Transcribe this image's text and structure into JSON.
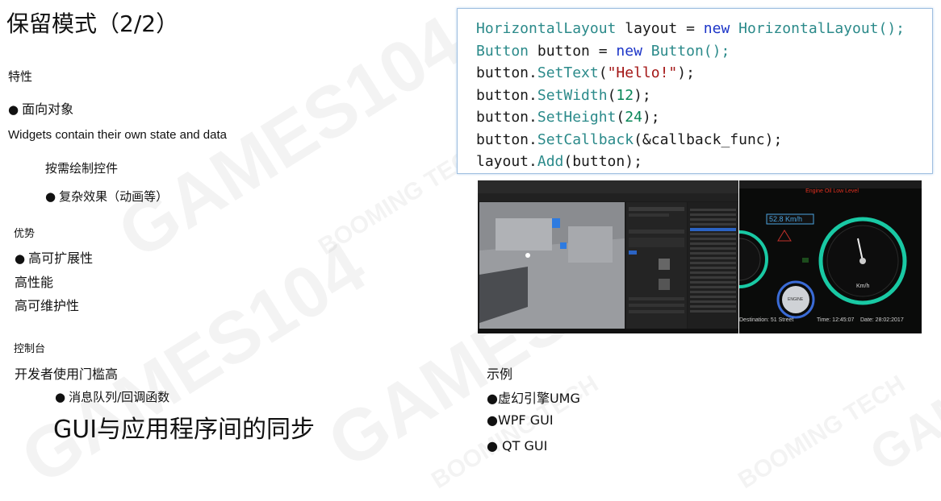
{
  "title": "保留模式（2/2）",
  "features": {
    "heading": "特性",
    "item1": "面向对象",
    "desc": "Widgets contain their own state and data",
    "sub1": "按需绘制控件",
    "sub2": "复杂效果（动画等）"
  },
  "advantages": {
    "heading": "优势",
    "item1": "高可扩展性",
    "item2": "高性能",
    "item3": "高可维护性"
  },
  "console": {
    "heading": "控制台",
    "item1": "开发者使用门槛高",
    "sub1": "消息队列/回调函数",
    "big": "GUI与应用程序间的同步"
  },
  "examples": {
    "heading": "示例",
    "items": [
      "●虚幻引擎UMG",
      "●WPF GUI",
      "● QT GUI"
    ]
  },
  "code": {
    "line1": {
      "type": "HorizontalLayout",
      "var": " layout = ",
      "kw": "new",
      "rest": " HorizontalLayout();"
    },
    "line2": {
      "type": "Button",
      "var": " button = ",
      "kw": "new",
      "rest": " Button();"
    },
    "line3": {
      "obj": "button.",
      "fn": "SetText",
      "open": "(",
      "str": "\"Hello!\"",
      "close": ");"
    },
    "line4": {
      "obj": "button.",
      "fn": "SetWidth",
      "open": "(",
      "num": "12",
      "close": ");"
    },
    "line5": {
      "obj": "button.",
      "fn": "SetHeight",
      "open": "(",
      "num": "24",
      "close": ");"
    },
    "line6": {
      "obj": "button.",
      "fn": "SetCallback",
      "args": "(&callback_func);"
    },
    "line7": {
      "obj": "layout.",
      "fn": "Add",
      "args": "(button);"
    }
  },
  "dashboard": {
    "header": "Engine Oil Low Level",
    "speed_readout": "52.8  Km/h",
    "unit": "Km/h",
    "destination": "Destination: 51 Street",
    "time": "Time: 12:45:07",
    "date": "Date: 28:02:2017",
    "center_label": "ENGINE"
  },
  "watermark": {
    "text1": "GAMES104",
    "text2": "BOOMING TECH"
  },
  "colors": {
    "code_type": "#2b8a8a",
    "code_kw": "#1c35c8",
    "code_str": "#a31515",
    "code_num": "#098658",
    "gauge_ring": "#19c9a4"
  }
}
